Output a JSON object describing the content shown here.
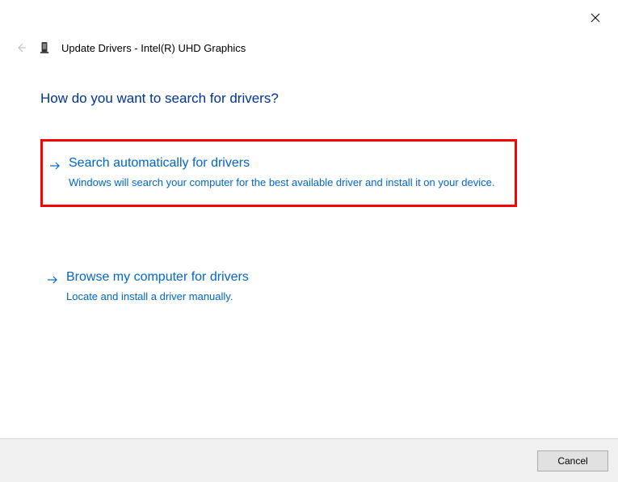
{
  "header": {
    "title": "Update Drivers - Intel(R) UHD Graphics"
  },
  "main": {
    "heading": "How do you want to search for drivers?"
  },
  "options": [
    {
      "title": "Search automatically for drivers",
      "description": "Windows will search your computer for the best available driver and install it on your device."
    },
    {
      "title": "Browse my computer for drivers",
      "description": "Locate and install a driver manually."
    }
  ],
  "footer": {
    "cancel_label": "Cancel"
  }
}
